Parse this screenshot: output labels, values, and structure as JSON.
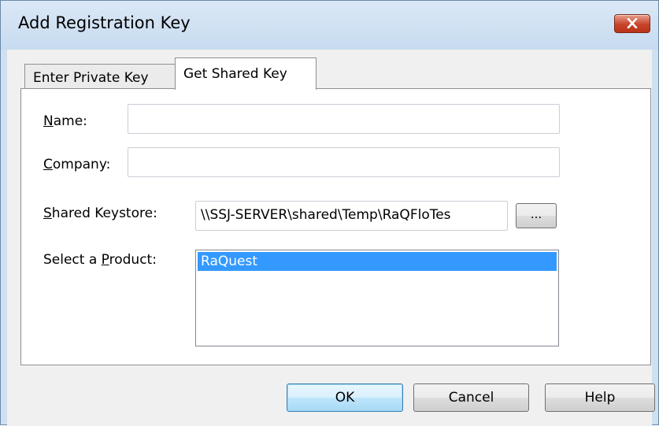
{
  "window": {
    "title": "Add Registration Key",
    "close_icon": "close-icon"
  },
  "tabs": [
    {
      "label": "Enter Private Key",
      "selected": false
    },
    {
      "label": "Get Shared Key",
      "selected": true
    }
  ],
  "form": {
    "name": {
      "label_underlined": "N",
      "label_rest": "ame:",
      "value": ""
    },
    "company": {
      "label_underlined": "C",
      "label_rest": "ompany:",
      "value": ""
    },
    "shared_keystore": {
      "label_underlined": "S",
      "label_rest": "hared Keystore:",
      "value": "\\\\SSJ-SERVER\\shared\\Temp\\RaQFloTes"
    },
    "browse_label": "...",
    "product": {
      "label_pre": "Select a ",
      "label_underlined": "P",
      "label_rest": "roduct:"
    },
    "products": [
      {
        "label": "RaQuest",
        "selected": true
      }
    ]
  },
  "buttons": {
    "ok": "OK",
    "cancel": "Cancel",
    "help": "Help"
  },
  "colors": {
    "selection": "#3399ff",
    "close_button": "#c7442b"
  }
}
